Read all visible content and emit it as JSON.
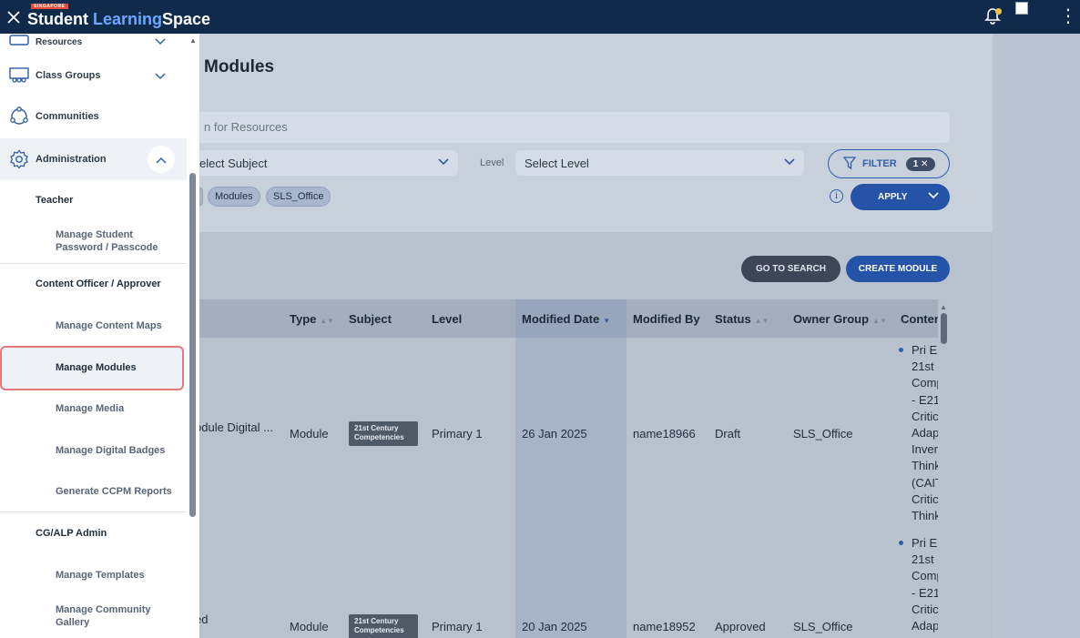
{
  "app": {
    "brand_tag": "SINGAPORE",
    "brand_part1": "Student",
    "brand_part2": "Learning",
    "brand_part3": "Space"
  },
  "sidebar": {
    "items": [
      {
        "label": "Resources",
        "icon": "resources-icon"
      },
      {
        "label": "Class Groups",
        "icon": "class-groups-icon"
      },
      {
        "label": "Communities",
        "icon": "communities-icon"
      },
      {
        "label": "Administration",
        "icon": "gear-icon"
      }
    ],
    "sections": [
      {
        "title": "Teacher",
        "items": [
          "Manage Student Password / Passcode"
        ]
      },
      {
        "title": "Content Officer / Approver",
        "items": [
          "Manage Content Maps",
          "Manage Modules",
          "Manage Media",
          "Manage Digital Badges",
          "Generate CCPM Reports"
        ]
      },
      {
        "title": "CG/ALP Admin",
        "items": [
          "Manage Templates",
          "Manage Community Gallery"
        ]
      }
    ],
    "active_item": "Manage Modules"
  },
  "main": {
    "title": "Modules",
    "search_placeholder": "n for Resources",
    "subject_select": "elect Subject",
    "level_label": "Level",
    "level_select": "Select Level",
    "filter_label": "FILTER",
    "filter_count": "1",
    "chips": [
      "Modules",
      "SLS_Office"
    ],
    "apply_label": "APPLY",
    "go_to_search_label": "GO TO SEARCH",
    "create_module_label": "CREATE MODULE"
  },
  "table": {
    "columns": [
      "Type",
      "Subject",
      "Level",
      "Modified Date",
      "Modified By",
      "Status",
      "Owner Group",
      "Conten"
    ],
    "sorted_column": "Modified Date",
    "rows": [
      {
        "title": "odule Digital ...",
        "type": "Module",
        "subject": "21st Century Competencies",
        "level": "Primary 1",
        "modified_date": "26 Jan 2025",
        "modified_by": "name18966",
        "status": "Draft",
        "owner_group": "SLS_Office",
        "content": "Pri Er\n21st (\nComp\n- E21\nCritic\nAdap\nInver\nThink\n(CAIT\nCritic\nThink"
      },
      {
        "title": "ed",
        "type": "Module",
        "subject": "21st Century Competencies",
        "level": "Primary 1",
        "modified_date": "20 Jan 2025",
        "modified_by": "name18952",
        "status": "Approved",
        "owner_group": "SLS_Office",
        "content": "Pri Er\n21st (\nComp\n- E21\nCritic\nAdap"
      }
    ]
  },
  "colors": {
    "topbar": "#0f2a4a",
    "accent_blue": "#2553a8",
    "active_outline": "#e27a7a",
    "notification_dot": "#f6c343"
  }
}
